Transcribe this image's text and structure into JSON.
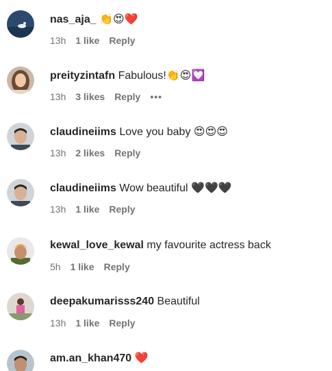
{
  "comments": [
    {
      "username": "nas_aja_",
      "text": "",
      "emoji": "👏😍❤️",
      "time": "13h",
      "likes": "1 like",
      "reply": "Reply",
      "more": ""
    },
    {
      "username": "preityzintafn",
      "text": " Fabulous!",
      "emoji": "👏😍💟",
      "time": "13h",
      "likes": "3 likes",
      "reply": "Reply",
      "more": "•••"
    },
    {
      "username": "claudineiims",
      "text": " Love you baby ",
      "emoji": "😍😍😍",
      "time": "13h",
      "likes": "2 likes",
      "reply": "Reply",
      "more": ""
    },
    {
      "username": "claudineiims",
      "text": " Wow beautiful ",
      "emoji": "🖤🖤🖤",
      "time": "13h",
      "likes": "1 like",
      "reply": "Reply",
      "more": ""
    },
    {
      "username": "kewal_love_kewal",
      "text": " my favourite actress back",
      "emoji": "",
      "time": "5h",
      "likes": "1 like",
      "reply": "Reply",
      "more": ""
    },
    {
      "username": "deepakumarisss240",
      "text": " Beautiful",
      "emoji": "",
      "time": "13h",
      "likes": "1 like",
      "reply": "Reply",
      "more": ""
    },
    {
      "username": "am.an_khan470",
      "text": " ",
      "emoji": "❤️",
      "time": "",
      "likes": "",
      "reply": "",
      "more": ""
    }
  ]
}
